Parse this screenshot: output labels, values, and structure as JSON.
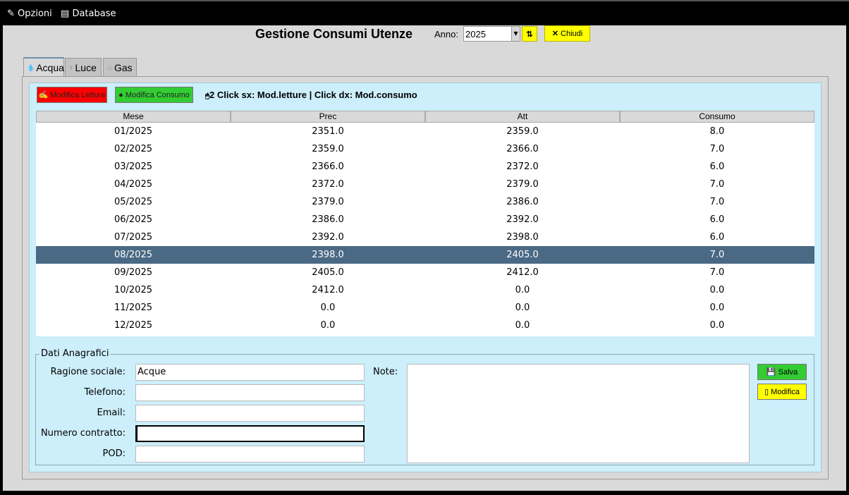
{
  "menu": {
    "opzioni": "Opzioni",
    "database": "Database"
  },
  "header": {
    "title": "Gestione Consumi Utenze",
    "anno_label": "Anno:",
    "anno_value": "2025",
    "chiudi": "Chiudi"
  },
  "tabs": [
    {
      "label": "Acqua"
    },
    {
      "label": "Luce"
    },
    {
      "label": "Gas"
    }
  ],
  "toolbar": {
    "modifica_letture": "Modifica Letture",
    "modifica_consumo": "Modifica Consumo",
    "hint": "2 Click sx: Mod.letture | Click dx: Mod.consumo"
  },
  "table": {
    "columns": [
      "Mese",
      "Prec",
      "Att",
      "Consumo"
    ],
    "rows": [
      [
        "01/2025",
        "2351.0",
        "2359.0",
        "8.0"
      ],
      [
        "02/2025",
        "2359.0",
        "2366.0",
        "7.0"
      ],
      [
        "03/2025",
        "2366.0",
        "2372.0",
        "6.0"
      ],
      [
        "04/2025",
        "2372.0",
        "2379.0",
        "7.0"
      ],
      [
        "05/2025",
        "2379.0",
        "2386.0",
        "7.0"
      ],
      [
        "06/2025",
        "2386.0",
        "2392.0",
        "6.0"
      ],
      [
        "07/2025",
        "2392.0",
        "2398.0",
        "6.0"
      ],
      [
        "08/2025",
        "2398.0",
        "2405.0",
        "7.0"
      ],
      [
        "09/2025",
        "2405.0",
        "2412.0",
        "7.0"
      ],
      [
        "10/2025",
        "2412.0",
        "0.0",
        "0.0"
      ],
      [
        "11/2025",
        "0.0",
        "0.0",
        "0.0"
      ],
      [
        "12/2025",
        "0.0",
        "0.0",
        "0.0"
      ]
    ],
    "selected_row": 7
  },
  "anagrafica": {
    "title": "Dati Anagrafici",
    "fields": [
      {
        "label": "Ragione sociale:",
        "value": "Acque"
      },
      {
        "label": "Telefono:",
        "value": ""
      },
      {
        "label": "Email:",
        "value": ""
      },
      {
        "label": "Numero contratto:",
        "value": ""
      },
      {
        "label": "POD:",
        "value": ""
      }
    ],
    "note_label": "Note:",
    "note_value": "",
    "salva": "Salva",
    "modifica": "Modifica"
  }
}
